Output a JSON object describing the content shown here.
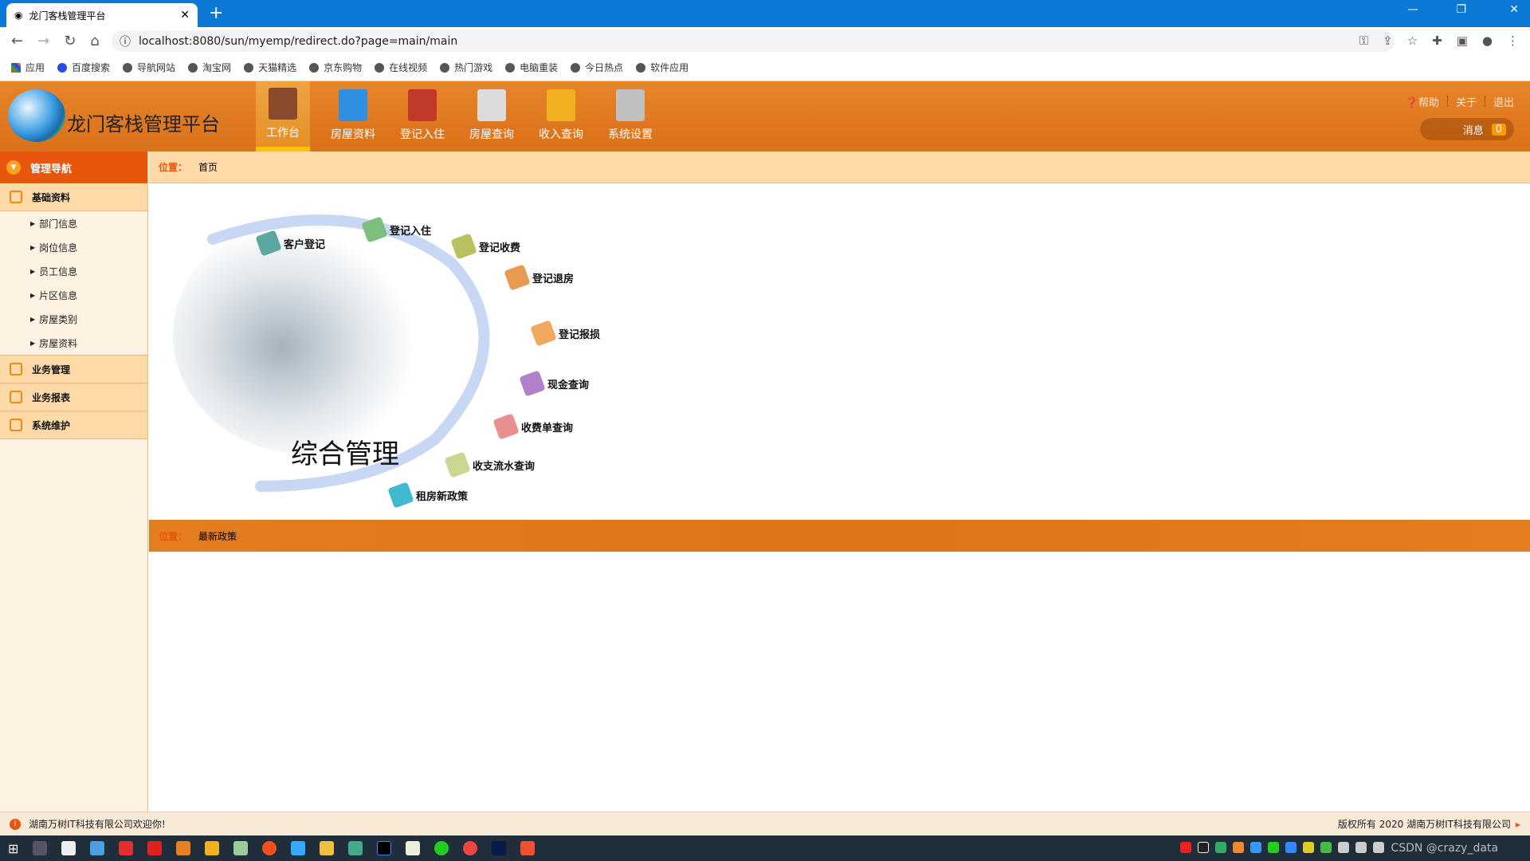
{
  "browser": {
    "tab_title": "龙门客栈管理平台",
    "url": "localhost:8080/sun/myemp/redirect.do?page=main/main",
    "bookmarks": [
      "应用",
      "百度搜索",
      "导航网站",
      "淘宝网",
      "天猫精选",
      "京东购物",
      "在线视频",
      "热门游戏",
      "电脑重装",
      "今日热点",
      "软件应用"
    ]
  },
  "header": {
    "title": "龙门客栈管理平台",
    "nav": [
      {
        "label": "工作台",
        "icon": "book-icon",
        "color": "#8b4a2b"
      },
      {
        "label": "房屋资料",
        "icon": "ruler-icon",
        "color": "#2f8fe0"
      },
      {
        "label": "登记入住",
        "icon": "pencil-icon",
        "color": "#c0392b"
      },
      {
        "label": "房屋查询",
        "icon": "printer-icon",
        "color": "#dcdcdc"
      },
      {
        "label": "收入查询",
        "icon": "folder-icon",
        "color": "#f0b020"
      },
      {
        "label": "系统设置",
        "icon": "tools-icon",
        "color": "#c0c0c0"
      }
    ],
    "links": {
      "help": "帮助",
      "about": "关于",
      "logout": "退出"
    },
    "message_label": "消息",
    "message_count": "0"
  },
  "sidebar": {
    "title": "管理导航",
    "groups": [
      {
        "label": "基础资料",
        "items": [
          "部门信息",
          "岗位信息",
          "员工信息",
          "片区信息",
          "房屋类别",
          "房屋资料"
        ]
      },
      {
        "label": "业务管理"
      },
      {
        "label": "业务报表"
      },
      {
        "label": "系统维护"
      }
    ]
  },
  "main": {
    "position_label": "位置：",
    "position": "首页",
    "center_title": "综合管理",
    "diagram_items": [
      {
        "label": "客户登记",
        "color": "#5aa8a0"
      },
      {
        "label": "登记入住",
        "color": "#7cbf7c"
      },
      {
        "label": "登记收费",
        "color": "#b8c060"
      },
      {
        "label": "登记退房",
        "color": "#e89a50"
      },
      {
        "label": "登记报损",
        "color": "#f0a860"
      },
      {
        "label": "现金查询",
        "color": "#b080c8"
      },
      {
        "label": "收费单查询",
        "color": "#e89090"
      },
      {
        "label": "收支流水查询",
        "color": "#c8d890"
      },
      {
        "label": "租房新政策",
        "color": "#40b8d0"
      }
    ],
    "section2_position": "最新政策"
  },
  "footer": {
    "welcome": "湖南万树IT科技有限公司欢迎你!",
    "copyright": "版权所有 2020 湖南万树IT科技有限公司"
  },
  "taskbar": {
    "watermark": "CSDN @crazy_data"
  }
}
